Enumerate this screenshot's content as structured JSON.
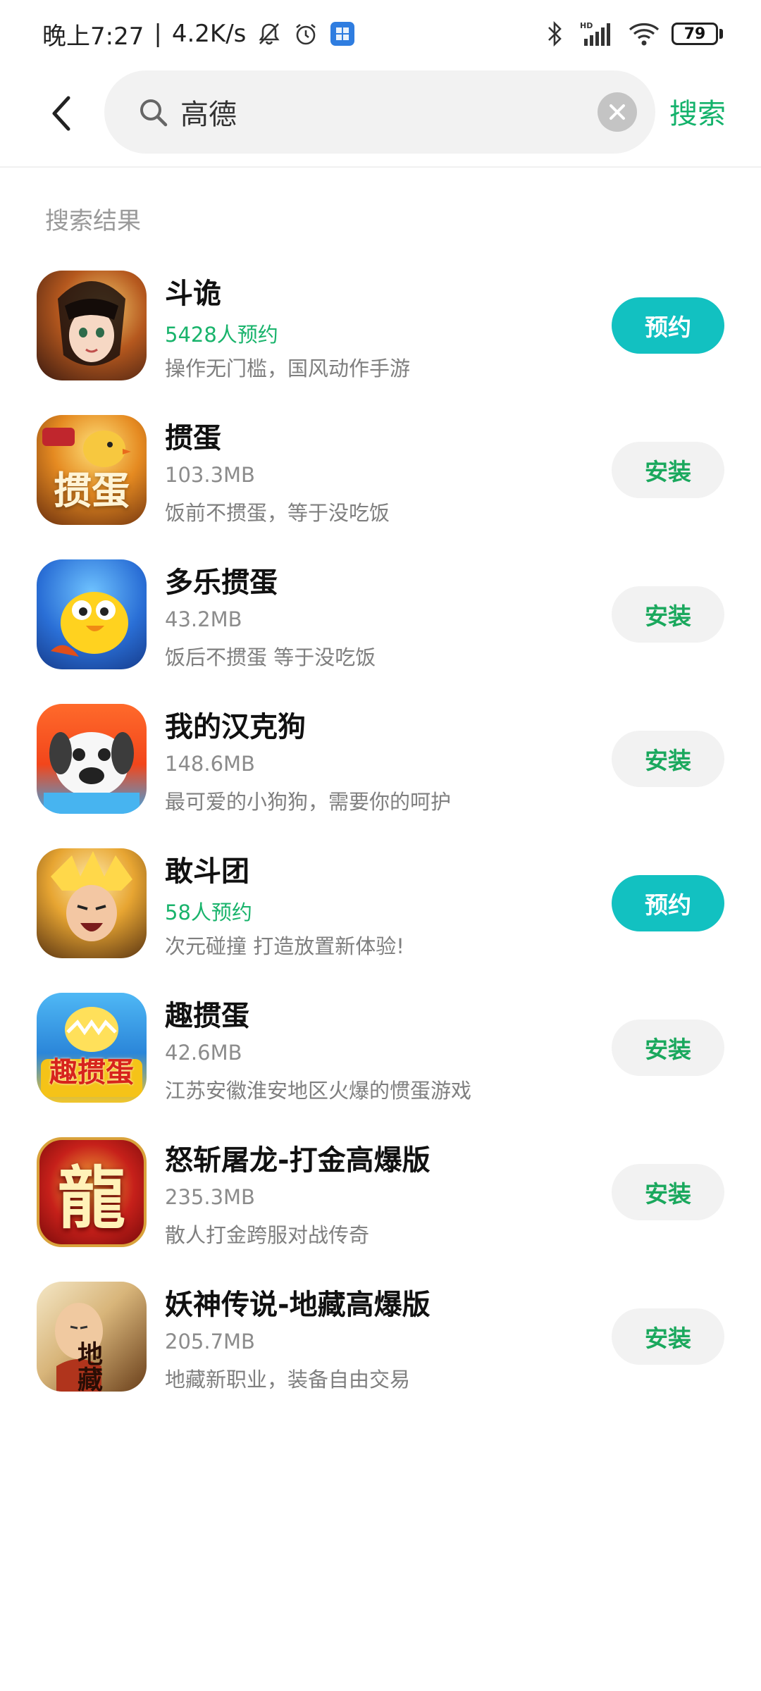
{
  "status_bar": {
    "time": "晚上7:27",
    "separator": "|",
    "net_speed": "4.2K/s",
    "battery": "79",
    "network_hd": "HD",
    "icons": [
      "mute-icon",
      "alarm-icon",
      "app-square-icon",
      "bluetooth-icon",
      "signal-icon",
      "wifi-icon",
      "battery-icon"
    ]
  },
  "search": {
    "value": "高德",
    "submit_label": "搜索"
  },
  "section_title": "搜索结果",
  "colors": {
    "accent_green": "#13b26b",
    "reserve_teal": "#12c1c1",
    "install_bg": "#f2f2f2"
  },
  "results": [
    {
      "name": "斗诡",
      "meta": "5428人预约",
      "meta_type": "reserve",
      "desc": "操作无门槛，国风动作手游",
      "action": "预约",
      "icon": "douyi-game-icon"
    },
    {
      "name": "掼蛋",
      "meta": "103.3MB",
      "meta_type": "size",
      "desc": "饭前不掼蛋，等于没吃饭",
      "action": "安装",
      "icon": "guandan-game-icon",
      "icon_text": "掼蛋"
    },
    {
      "name": "多乐掼蛋",
      "meta": "43.2MB",
      "meta_type": "size",
      "desc": "饭后不掼蛋 等于没吃饭",
      "action": "安装",
      "icon": "duole-chick-icon"
    },
    {
      "name": "我的汉克狗",
      "meta": "148.6MB",
      "meta_type": "size",
      "desc": "最可爱的小狗狗，需要你的呵护",
      "action": "安装",
      "icon": "hank-dog-icon"
    },
    {
      "name": "敢斗团",
      "meta": "58人预约",
      "meta_type": "reserve",
      "desc": "次元碰撞 打造放置新体验!",
      "action": "预约",
      "icon": "gandoutuan-hero-icon"
    },
    {
      "name": "趣掼蛋",
      "meta": "42.6MB",
      "meta_type": "size",
      "desc": "江苏安徽淮安地区火爆的惯蛋游戏",
      "action": "安装",
      "icon": "qu-guandan-icon",
      "icon_text": "趣掼蛋"
    },
    {
      "name": "怒斩屠龙-打金高爆版",
      "meta": "235.3MB",
      "meta_type": "size",
      "desc": "散人打金跨服对战传奇",
      "action": "安装",
      "icon": "dragon-character-icon",
      "icon_text": "龍"
    },
    {
      "name": "妖神传说-地藏高爆版",
      "meta": "205.7MB",
      "meta_type": "size",
      "desc": "地藏新职业，装备自由交易",
      "action": "安装",
      "icon": "dizang-monk-icon",
      "icon_text": "地藏"
    }
  ]
}
